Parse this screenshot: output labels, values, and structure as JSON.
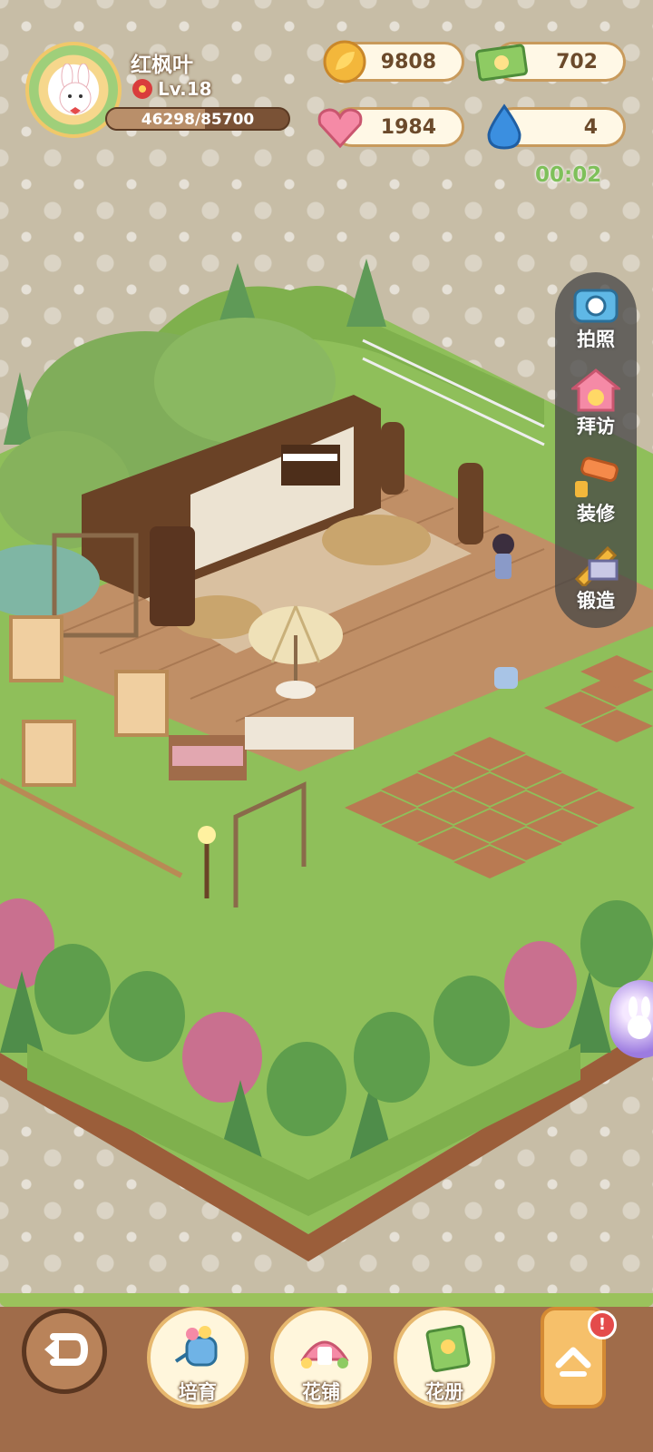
{
  "player": {
    "name": "红枫叶",
    "level": "Lv.18",
    "xp_text": "46298/85700",
    "xp_progress": 0.54
  },
  "resources": [
    {
      "icon": "leaf-coin-icon",
      "value": "9808"
    },
    {
      "icon": "ticket-icon",
      "value": "702"
    },
    {
      "icon": "heart-gem-icon",
      "value": "1984"
    },
    {
      "icon": "water-drop-icon",
      "value": "4"
    }
  ],
  "timer": "00:02",
  "side_menu": [
    {
      "label": "拍照",
      "icon": "camera-icon"
    },
    {
      "label": "拜访",
      "icon": "house-visit-icon"
    },
    {
      "label": "装修",
      "icon": "paint-roller-icon"
    },
    {
      "label": "锻造",
      "icon": "forge-hammer-icon"
    }
  ],
  "bottom_nav": [
    {
      "label": "培育",
      "icon": "watering-can-icon"
    },
    {
      "label": "花铺",
      "icon": "flower-shop-icon"
    },
    {
      "label": "花册",
      "icon": "flower-book-icon"
    }
  ],
  "notification_badge": "!",
  "colors": {
    "accent": "#c89a5c",
    "grass": "#8fbf5a",
    "deck": "#b98a63",
    "timer": "#7ec05a"
  }
}
